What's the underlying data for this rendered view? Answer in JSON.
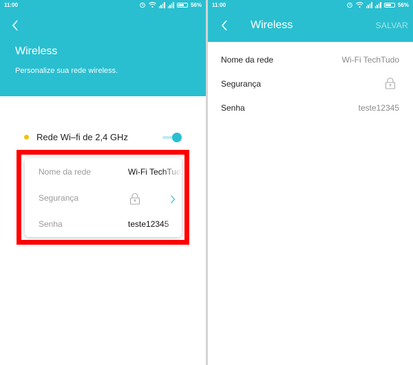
{
  "status_bar": {
    "time": "11:00",
    "battery": "56%",
    "icons": [
      "alarm-icon",
      "wifi-icon",
      "signal-icon",
      "signal-icon",
      "battery-icon"
    ]
  },
  "left_screen": {
    "header": {
      "title": "Wireless",
      "subtitle": "Personalize sua rede wireless."
    },
    "band": {
      "label": "Rede Wi–fi de 2,4 GHz",
      "enabled": true
    },
    "card": {
      "network_name_label": "Nome da rede",
      "network_name_value": "Wi-Fi TechTudo",
      "security_label": "Segurança",
      "password_label": "Senha",
      "password_value": "teste12345"
    },
    "highlight_color": "#ff0000"
  },
  "right_screen": {
    "appbar": {
      "title": "Wireless",
      "save_label": "SALVAR"
    },
    "rows": {
      "network_name_label": "Nome da rede",
      "network_name_value": "Wi-Fi TechTudo",
      "security_label": "Segurança",
      "password_label": "Senha",
      "password_value": "teste12345"
    }
  },
  "colors": {
    "accent": "#29bfd0",
    "band_dot": "#f2c200"
  }
}
